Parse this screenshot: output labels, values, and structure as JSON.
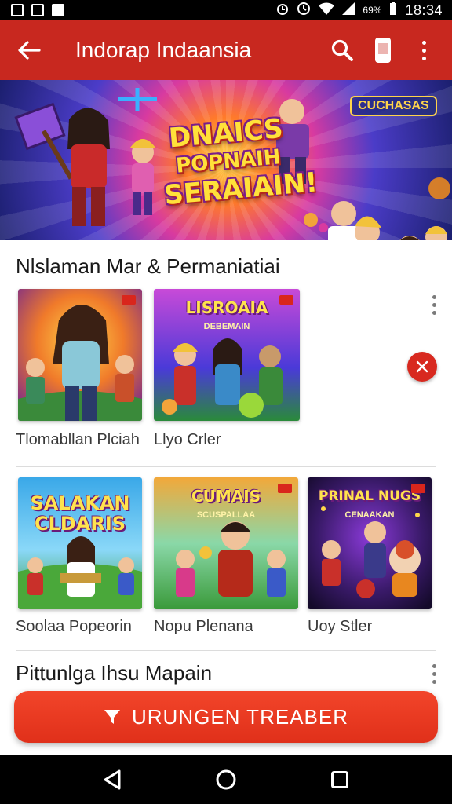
{
  "status_bar": {
    "time": "18:34",
    "battery": "69%",
    "icons": [
      "sim-icon",
      "image-icon",
      "notification-icon",
      "alarm-icon",
      "clock-icon",
      "wifi-icon",
      "signal-icon",
      "battery-icon"
    ]
  },
  "app_bar": {
    "title": "Indorap Indaansia",
    "color": "#c8281f",
    "icons": [
      "back-arrow-icon",
      "search-icon",
      "phone-icon",
      "more-vert-icon"
    ]
  },
  "hero": {
    "headline_lines": [
      "DNAICS",
      "POPNAIH",
      "SERAIAIN!"
    ],
    "corner_text": "CUCHASAS"
  },
  "section1": {
    "title": "Nlslaman Mar & Permaniatiai",
    "items": [
      {
        "label": "Tlomabllan Plciah",
        "badge": true
      },
      {
        "label": "Llyo Crler",
        "art_title": "LISROAIA",
        "art_sub": "DEBEMAIN",
        "badge": true
      }
    ]
  },
  "section2": {
    "items": [
      {
        "label": "Soolaa Popeorin",
        "art_title": "SALAKAN CLDARIS"
      },
      {
        "label": "Nopu Plenana",
        "art_title": "CUMAIS",
        "art_sub": "SCUSPALLAA",
        "badge": true
      },
      {
        "label": "Uoy Stler",
        "art_title": "PRINAL NUGS",
        "art_sub": "CENAAKAN",
        "badge": true
      }
    ]
  },
  "section3": {
    "title": "Pittunlga Ihsu Mapain"
  },
  "cta": {
    "label": "URUNGEN TREABER",
    "color": "#e8371f"
  },
  "nav_bar": {
    "icons": [
      "back-triangle-icon",
      "home-circle-icon",
      "recents-square-icon"
    ]
  }
}
